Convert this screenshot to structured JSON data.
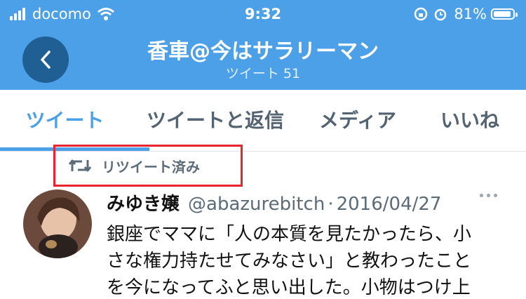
{
  "status_bar": {
    "carrier": "docomo",
    "time": "9:32",
    "battery": "81%"
  },
  "header": {
    "back_label": "‹",
    "title": "香車@今はサラリーマン",
    "subtitle": "ツイート 51"
  },
  "tabs": [
    {
      "label": "ツイート",
      "active": true
    },
    {
      "label": "ツイートと返信",
      "active": false
    },
    {
      "label": "メディア",
      "active": false
    },
    {
      "label": "いいね",
      "active": false
    }
  ],
  "retweet_label": "リツイート済み",
  "tweet": {
    "name": "みゆき嬢",
    "handle": "@abazurebitch",
    "separator": "·",
    "date": "2016/04/27",
    "lines": [
      "銀座でママに「人の本質を見たかったら、小",
      "さな権力持たせてみなさい」と教わったこと",
      "を今になってふと思い出した。小物はつけ上"
    ]
  },
  "colors": {
    "accent": "#4ca0e8",
    "highlight_box": "#e8252e"
  }
}
